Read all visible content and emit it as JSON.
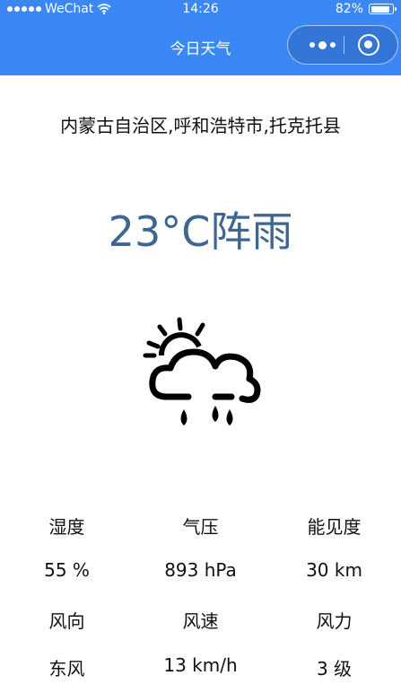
{
  "status_bar": {
    "carrier": "WeChat",
    "time": "14:26",
    "battery": "82%"
  },
  "nav": {
    "title": "今日天气"
  },
  "weather": {
    "location": "内蒙古自治区,呼和浩特市,托克托县",
    "temp_condition": "23°C阵雨",
    "icon": "cloud-sun-rain-icon"
  },
  "details": {
    "labels_row1": [
      "湿度",
      "气压",
      "能见度"
    ],
    "values_row1": [
      "55 %",
      "893 hPa",
      "30 km"
    ],
    "labels_row2": [
      "风向",
      "风速",
      "风力"
    ],
    "values_row2": [
      "东风",
      "13 km/h",
      "3 级"
    ]
  },
  "colors": {
    "nav_bg": "#3b87f5",
    "temp_text": "#3e6690"
  }
}
